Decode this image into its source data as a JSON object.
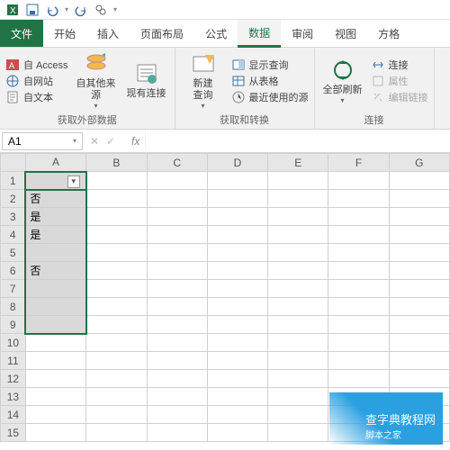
{
  "qat": {
    "tips": [
      "save",
      "undo",
      "redo",
      "touch",
      "dropdown"
    ]
  },
  "tabs": {
    "file": "文件",
    "items": [
      "开始",
      "插入",
      "页面布局",
      "公式",
      "数据",
      "审阅",
      "视图",
      "方格"
    ],
    "active_index": 4
  },
  "ribbon": {
    "group1": {
      "label": "获取外部数据",
      "stack": [
        {
          "icon": "access",
          "label": "自 Access"
        },
        {
          "icon": "web",
          "label": "自网站"
        },
        {
          "icon": "text",
          "label": "自文本"
        }
      ],
      "btn1": {
        "label": "自其他来源"
      },
      "btn2": {
        "label": "现有连接"
      }
    },
    "group2": {
      "label": "获取和转换",
      "btn1": {
        "label": "新建\n查询"
      },
      "stack": [
        {
          "icon": "show",
          "label": "显示查询"
        },
        {
          "icon": "table",
          "label": "从表格"
        },
        {
          "icon": "recent",
          "label": "最近使用的源"
        }
      ]
    },
    "group3": {
      "label": "连接",
      "btn1": {
        "label": "全部刷新"
      },
      "stack": [
        {
          "icon": "conn",
          "label": "连接"
        },
        {
          "icon": "prop",
          "label": "属性"
        },
        {
          "icon": "editlink",
          "label": "编辑链接"
        }
      ]
    }
  },
  "formula_bar": {
    "cell_ref": "A1",
    "formula": ""
  },
  "sheet": {
    "cols": [
      "A",
      "B",
      "C",
      "D",
      "E",
      "F",
      "G"
    ],
    "row_count": 15,
    "selected_col": 0,
    "selected_rows": [
      1,
      9
    ],
    "filter_row": 1,
    "cells": {
      "A2": "否",
      "A3": "是",
      "A4": "是",
      "A6": "否"
    }
  },
  "watermark": {
    "main": "查字典教程网",
    "site": "脚本之家"
  }
}
